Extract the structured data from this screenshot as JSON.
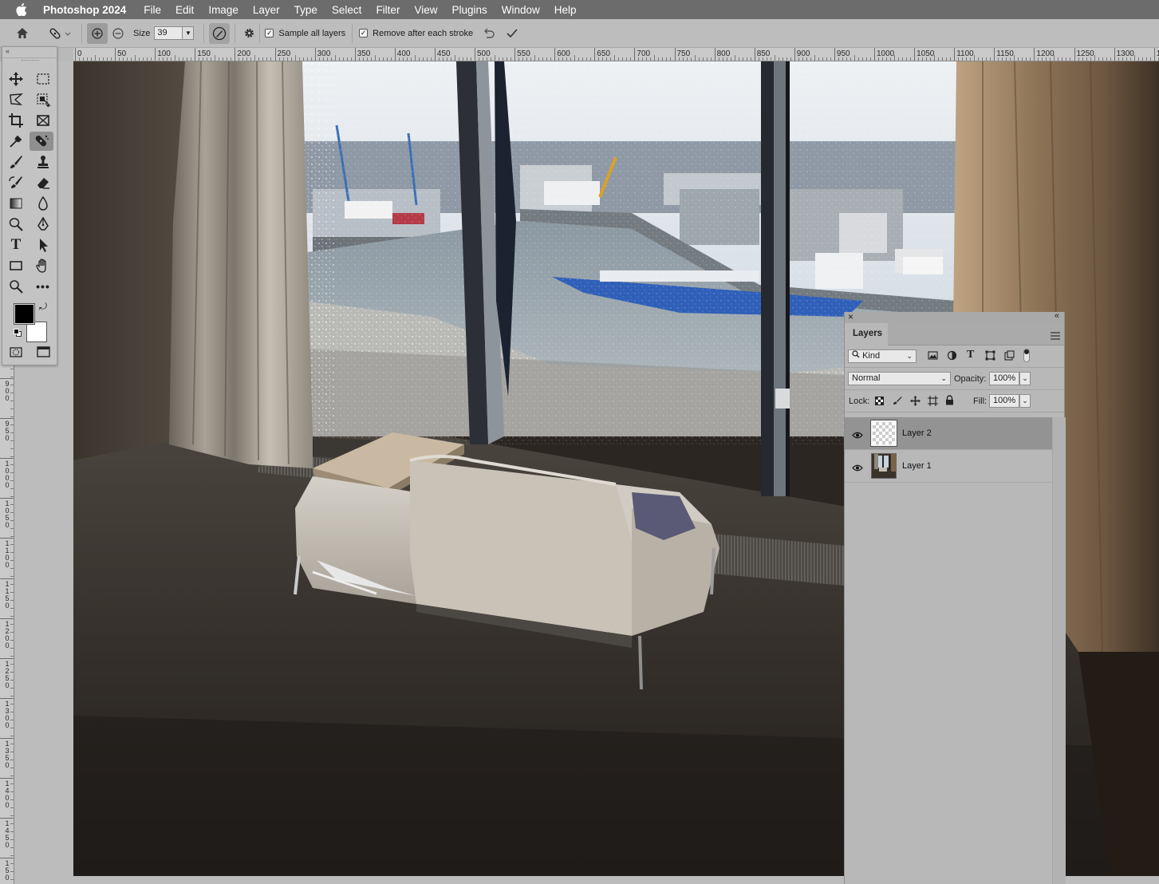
{
  "menubar": {
    "apple_icon": "apple-logo-icon",
    "app_name": "Photoshop 2024",
    "items": [
      "File",
      "Edit",
      "Image",
      "Layer",
      "Type",
      "Select",
      "Filter",
      "View",
      "Plugins",
      "Window",
      "Help"
    ]
  },
  "options_bar": {
    "size_label": "Size",
    "size_value": "39",
    "sample_all_layers_label": "Sample all layers",
    "sample_all_layers_checked": true,
    "remove_after_stroke_label": "Remove after each stroke",
    "remove_after_stroke_checked": true,
    "check_glyph": "✓"
  },
  "ruler_top": {
    "labels": [
      "0",
      "50",
      "100",
      "150",
      "200",
      "250",
      "300",
      "350",
      "400",
      "450",
      "500",
      "550",
      "600",
      "650",
      "700",
      "750",
      "800",
      "850",
      "900",
      "950",
      "1000",
      "1050",
      "1100",
      "1150",
      "1200",
      "1250",
      "1300",
      "13"
    ]
  },
  "ruler_left": {
    "labels": [
      "900",
      "950",
      "1000",
      "1050",
      "1100",
      "1150",
      "1200",
      "1250",
      "1300",
      "1350",
      "1400",
      "1450",
      "150"
    ]
  },
  "toolbar": {
    "collapse_glyph": "«",
    "tools": [
      "move-tool-icon",
      "marquee-tool-icon",
      "lasso-tool-icon",
      "object-selection-tool-icon",
      "crop-tool-icon",
      "frame-tool-icon",
      "eyedropper-tool-icon",
      "remove-tool-icon",
      "brush-tool-icon",
      "clone-stamp-tool-icon",
      "history-brush-tool-icon",
      "eraser-tool-icon",
      "gradient-tool-icon",
      "blur-tool-icon",
      "dodge-tool-icon",
      "pen-tool-icon",
      "type-tool-icon",
      "path-selection-tool-icon",
      "rectangle-tool-icon",
      "hand-tool-icon",
      "zoom-tool-icon",
      "more-tools-icon"
    ],
    "type_glyph": "T",
    "more_glyph": "•••",
    "swap_glyph": "⤾",
    "foreground_color": "#000000",
    "background_color": "#ffffff"
  },
  "layers_panel": {
    "close_glyph": "×",
    "collapse_glyph": "«",
    "tab_label": "Layers",
    "filter_kind": "Kind",
    "type_glyph": "T",
    "blend_mode": "Normal",
    "opacity_label": "Opacity:",
    "opacity_value": "100%",
    "lock_label": "Lock:",
    "fill_label": "Fill:",
    "fill_value": "100%",
    "layers": [
      {
        "name": "Layer 2",
        "selected": true,
        "visible": true
      },
      {
        "name": "Layer 1",
        "selected": false,
        "visible": true
      }
    ]
  },
  "colors": {
    "menubar_bg": "#6c6c6c",
    "panel_bg": "#b8b8b8",
    "selected_layer_bg": "#939393",
    "ship_blue": "#2f5fb8"
  }
}
